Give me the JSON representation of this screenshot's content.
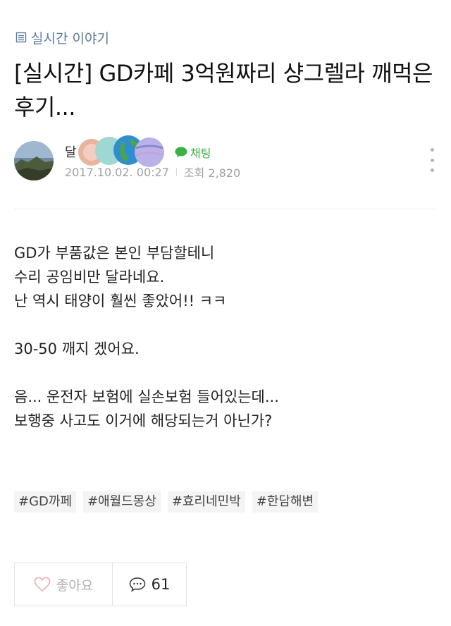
{
  "board": {
    "label": "실시간 이야기",
    "icon": "board-list-icon"
  },
  "post": {
    "title": "[실시간] GD카페 3억원짜리 샹그렐라 깨먹은 후기...",
    "author_initial": "달",
    "date": "2017.10.02. 00:27",
    "views_label": "조회 2,820",
    "chat_label": "채팅",
    "chat_color": "#3cb043"
  },
  "content": {
    "lines_1": [
      "GD가 부품값은 본인 부담할테니",
      "수리 공임비만 달라네요.",
      "난 역시 태양이 훨씬 좋았어!! ㅋㅋ"
    ],
    "line_2": "30-50 깨지 겠어요.",
    "lines_3": [
      "음... 운전자 보험에 실손보험 들어있는데...",
      "보행중 사고도 이거에 해당되는거 아닌가?"
    ]
  },
  "tags": [
    "#GD까페",
    "#애월드몽상",
    "#효리네민박",
    "#한담해변"
  ],
  "actions": {
    "like_label": "좋아요",
    "comment_count": "61"
  },
  "colors": {
    "board_link": "#5c7a9c",
    "text": "#222222",
    "meta": "#a0a0a0",
    "tag_bg": "#f4f4f4"
  }
}
